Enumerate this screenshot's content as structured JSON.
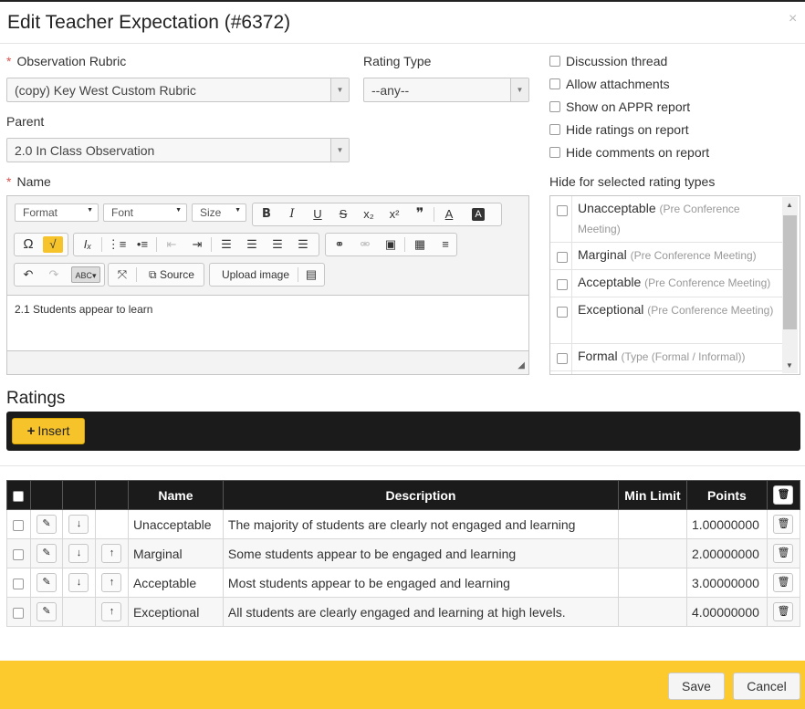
{
  "dialog": {
    "title": "Edit Teacher Expectation (#6372)",
    "close_glyph": "×"
  },
  "form": {
    "rubric_label": "Observation Rubric",
    "rubric_value": "(copy) Key West Custom Rubric",
    "rating_type_label": "Rating Type",
    "rating_type_value": "--any--",
    "parent_label": "Parent",
    "parent_value": "2.0 In Class Observation",
    "name_label": "Name",
    "required_marker": "*",
    "options": [
      {
        "label": "Discussion thread",
        "checked": false
      },
      {
        "label": "Allow attachments",
        "checked": false
      },
      {
        "label": "Show on APPR report",
        "checked": false
      },
      {
        "label": "Hide ratings on report",
        "checked": false
      },
      {
        "label": "Hide comments on report",
        "checked": false
      }
    ],
    "hide_label": "Hide for selected rating types",
    "hide_items": [
      {
        "name": "Unacceptable",
        "sub": "(Pre Conference Meeting)"
      },
      {
        "name": "Marginal",
        "sub": "(Pre Conference Meeting)"
      },
      {
        "name": "Acceptable",
        "sub": "(Pre Conference Meeting)"
      },
      {
        "name": "Exceptional",
        "sub": "(Pre Conference Meeting)"
      },
      {
        "name": "Formal",
        "sub": "(Type (Formal / Informal))"
      }
    ]
  },
  "editor": {
    "format_label": "Format",
    "font_label": "Font",
    "size_label": "Size",
    "source_label": "Source",
    "upload_label": "Upload image",
    "content": "2.1 Students appear to learn",
    "icons": {
      "bold": "B",
      "italic": "I",
      "underline": "U",
      "strike": "S",
      "subscript": "x₂",
      "superscript": "x²",
      "blockquote": "❞",
      "text_color": "A",
      "bg_color": "A",
      "omega": "Ω",
      "spell": "√",
      "remove_format": "Iₓ",
      "ordered_list": "⅓",
      "bullet_list": "☰",
      "undo": "↶",
      "redo": "↷",
      "maximize": "⤧",
      "source_icon": "⧉",
      "link": "⊘",
      "unlink": "⊗",
      "image": "▣",
      "table": "▦",
      "hr": "≡"
    }
  },
  "ratings": {
    "title": "Ratings",
    "insert_label": "Insert",
    "insert_glyph": "+",
    "headers": {
      "name": "Name",
      "description": "Description",
      "min_limit": "Min Limit",
      "points": "Points"
    },
    "rows": [
      {
        "name": "Unacceptable",
        "description": "The majority of students are clearly not engaged and learning",
        "min_limit": "",
        "points": "1.00000000",
        "has_down": true,
        "has_up": false
      },
      {
        "name": "Marginal",
        "description": "Some students appear to be engaged and learning",
        "min_limit": "",
        "points": "2.00000000",
        "has_down": true,
        "has_up": true
      },
      {
        "name": "Acceptable",
        "description": "Most students appear to be engaged and learning",
        "min_limit": "",
        "points": "3.00000000",
        "has_down": true,
        "has_up": true
      },
      {
        "name": "Exceptional",
        "description": "All students are clearly engaged and learning at high levels.",
        "min_limit": "",
        "points": "4.00000000",
        "has_down": false,
        "has_up": true
      }
    ]
  },
  "footer": {
    "save_label": "Save",
    "cancel_label": "Cancel"
  },
  "colors": {
    "accent": "#fdca2d",
    "dark_bar": "#1b1b1b",
    "required": "#d9534f"
  }
}
